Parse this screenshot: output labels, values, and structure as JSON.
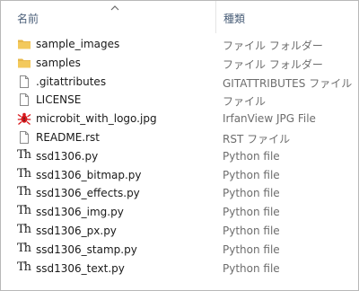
{
  "columns": {
    "name": "名前",
    "type": "種類"
  },
  "files": [
    {
      "name": "sample_images",
      "type": "ファイル フォルダー",
      "icon": "folder-icon"
    },
    {
      "name": "samples",
      "type": "ファイル フォルダー",
      "icon": "folder-icon"
    },
    {
      "name": ".gitattributes",
      "type": "GITATTRIBUTES ファイル",
      "icon": "file-icon"
    },
    {
      "name": "LICENSE",
      "type": "ファイル",
      "icon": "file-icon"
    },
    {
      "name": "microbit_with_logo.jpg",
      "type": "IrfanView JPG File",
      "icon": "irfanview-icon"
    },
    {
      "name": "README.rst",
      "type": "RST ファイル",
      "icon": "file-icon"
    },
    {
      "name": "ssd1306.py",
      "type": "Python file",
      "icon": "python-file-icon"
    },
    {
      "name": "ssd1306_bitmap.py",
      "type": "Python file",
      "icon": "python-file-icon"
    },
    {
      "name": "ssd1306_effects.py",
      "type": "Python file",
      "icon": "python-file-icon"
    },
    {
      "name": "ssd1306_img.py",
      "type": "Python file",
      "icon": "python-file-icon"
    },
    {
      "name": "ssd1306_px.py",
      "type": "Python file",
      "icon": "python-file-icon"
    },
    {
      "name": "ssd1306_stamp.py",
      "type": "Python file",
      "icon": "python-file-icon"
    },
    {
      "name": "ssd1306_text.py",
      "type": "Python file",
      "icon": "python-file-icon"
    }
  ],
  "colors": {
    "header_text": "#4c607a",
    "folder": "#e8b84a",
    "type_text": "#6d6d6d",
    "irfanview_red": "#d8181c"
  }
}
